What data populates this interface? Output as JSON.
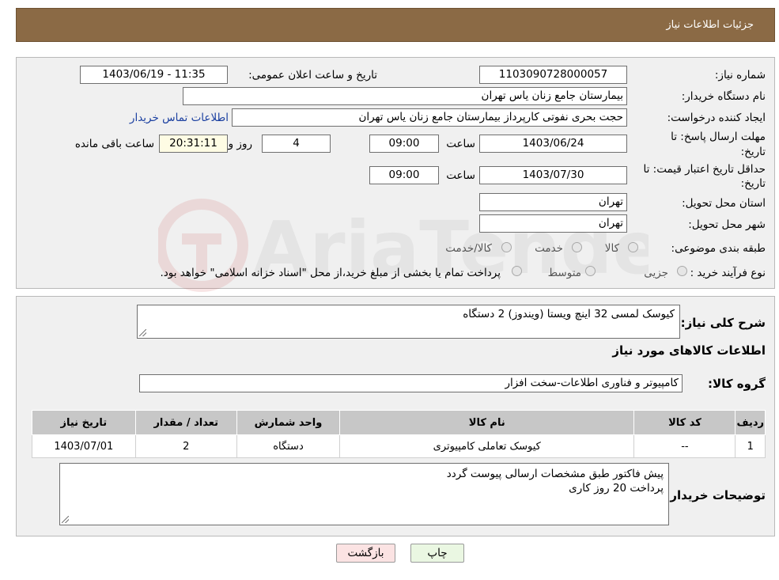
{
  "header": {
    "title": "جزئیات اطلاعات نیاز"
  },
  "form": {
    "need_number_label": "شماره نیاز:",
    "need_number": "1103090728000057",
    "announce_label": "تاریخ و ساعت اعلان عمومی:",
    "announce_value": "1403/06/19 - 11:35",
    "buyer_org_label": "نام دستگاه خریدار:",
    "buyer_org": "بیمارستان جامع زنان یاس تهران",
    "creator_label": "ایجاد کننده درخواست:",
    "creator": "حجت بحری نفوتی کارپرداز بیمارستان جامع زنان یاس تهران",
    "contact_link": "اطلاعات تماس خریدار",
    "reply_deadline_label_1": "مهلت ارسال پاسخ: تا",
    "reply_deadline_label_2": "تاریخ:",
    "reply_date": "1403/06/24",
    "time_label": "ساعت",
    "reply_time": "09:00",
    "days_value": "4",
    "days_label": "روز و",
    "remaining_time": "20:31:11",
    "remaining_label": "ساعت باقی مانده",
    "price_validity_label_1": "حداقل تاریخ اعتبار قیمت: تا",
    "price_validity_label_2": "تاریخ:",
    "price_date": "1403/07/30",
    "price_time": "09:00",
    "province_label": "استان محل تحویل:",
    "province": "تهران",
    "city_label": "شهر محل تحویل:",
    "city": "تهران",
    "category_label": "طبقه بندی موضوعی:",
    "category_options": [
      "کالا",
      "خدمت",
      "کالا/خدمت"
    ],
    "purchase_type_label": "نوع فرآیند خرید :",
    "purchase_options": [
      "جزیی",
      "متوسط"
    ],
    "purchase_note": "پرداخت تمام یا بخشی از مبلغ خرید،از محل \"اسناد خزانه اسلامی\" خواهد بود."
  },
  "details": {
    "summary_label": "شرح کلی نیاز:",
    "summary_value": "کیوسک لمسی 32 اینچ ویستا (ویندوز) 2 دستگاه",
    "goods_info_title": "اطلاعات کالاهای مورد نیاز",
    "group_label": "گروه کالا:",
    "group_value": "کامپیوتر و فناوری اطلاعات-سخت افزار",
    "table": {
      "headers": [
        "ردیف",
        "کد کالا",
        "نام کالا",
        "واحد شمارش",
        "تعداد / مقدار",
        "تاریخ نیاز"
      ],
      "rows": [
        [
          "1",
          "--",
          "کیوسک تعاملی کامپیوتری",
          "دستگاه",
          "2",
          "1403/07/01"
        ]
      ]
    },
    "buyer_notes_label": "توضیحات خریدار:",
    "buyer_notes_line1": "پیش فاکتور طبق مشخصات ارسالی پیوست گردد",
    "buyer_notes_line2": "پرداخت 20 روز کاری"
  },
  "buttons": {
    "print": "چاپ",
    "back": "بازگشت"
  },
  "watermark": {
    "text": "AriaTender.neT"
  },
  "colors": {
    "header_bg": "#8b6a45",
    "print_btn_bg": "#eaf7e2",
    "back_btn_bg": "#fbe3e3",
    "link": "#1a3fa0"
  }
}
